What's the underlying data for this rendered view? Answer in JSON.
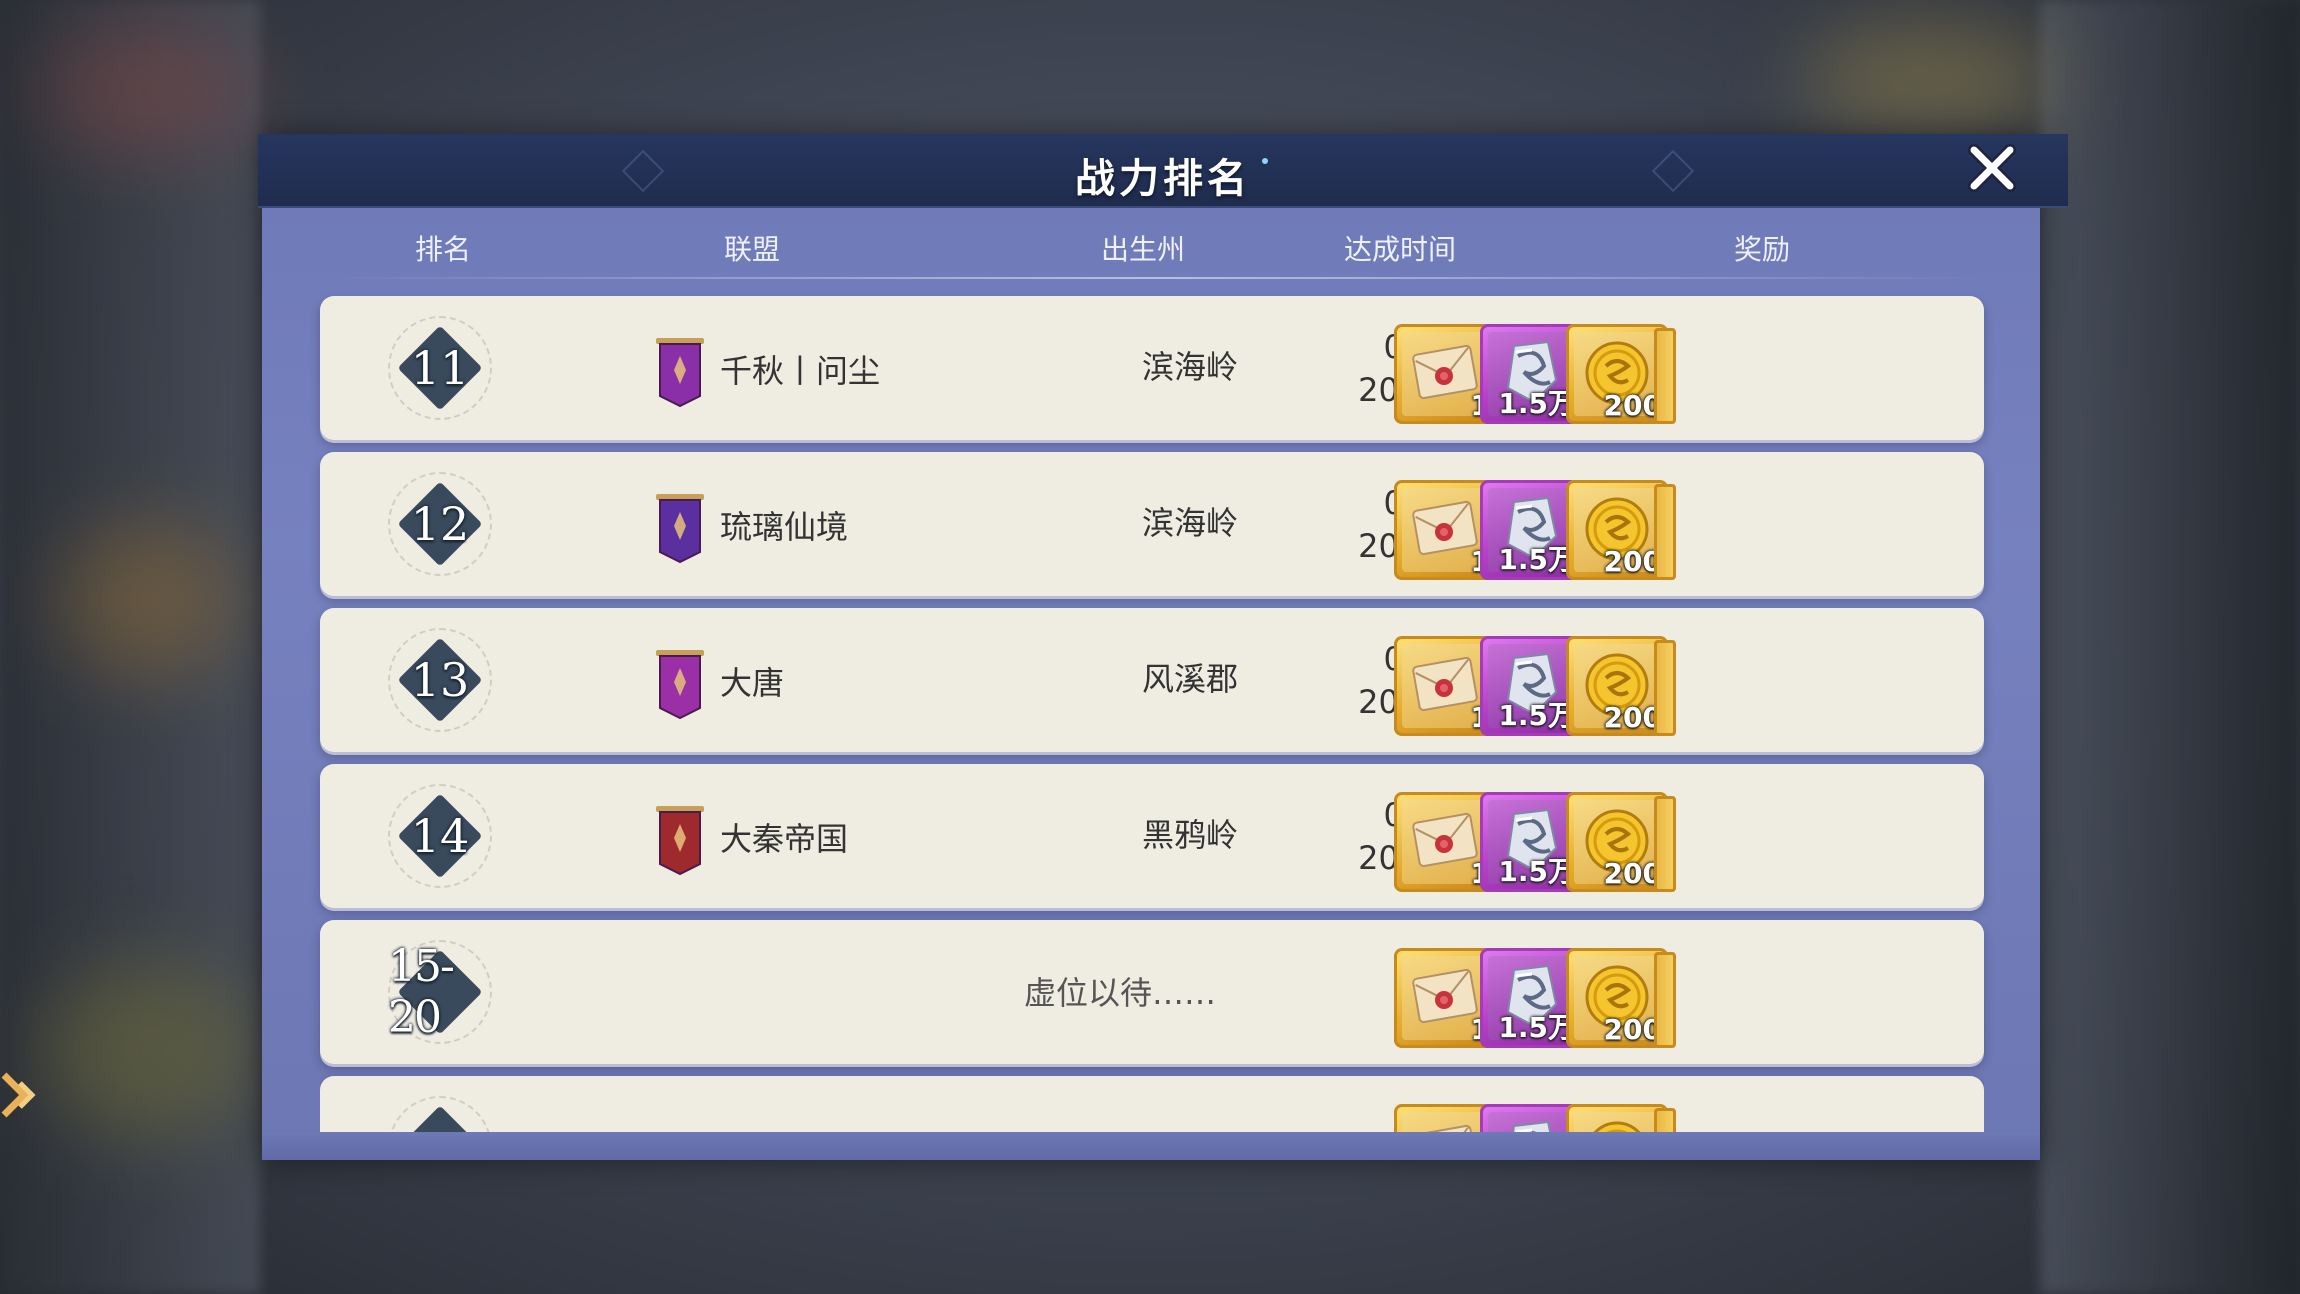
{
  "title": "战力排名",
  "headers": {
    "rank": "排名",
    "alliance": "联盟",
    "state": "出生州",
    "time": "达成时间",
    "reward": "奖励"
  },
  "rewards": [
    {
      "icon": "letter-envelope-icon",
      "qty": "1",
      "frame": "gold"
    },
    {
      "icon": "silver-crystal-icon",
      "qty": "1.5万",
      "frame": "purple"
    },
    {
      "icon": "gold-coin-icon",
      "qty": "200",
      "frame": "gold"
    }
  ],
  "rows": [
    {
      "rank": "11",
      "alliance": "千秋丨问尘",
      "state": "滨海岭",
      "date": "04-02",
      "time": "20:16:44",
      "banner_color": "#8a2fa8"
    },
    {
      "rank": "12",
      "alliance": "琉璃仙境",
      "state": "滨海岭",
      "date": "04-02",
      "time": "20:21:14",
      "banner_color": "#5a2fa0"
    },
    {
      "rank": "13",
      "alliance": "大唐",
      "state": "风溪郡",
      "date": "04-02",
      "time": "20:26:51",
      "banner_color": "#9a2fa8"
    },
    {
      "rank": "14",
      "alliance": "大秦帝国",
      "state": "黑鸦岭",
      "date": "04-02",
      "time": "20:35:57",
      "banner_color": "#9e2a2e"
    }
  ],
  "placeholder_row": {
    "rank": "15-20",
    "text": "虚位以待……"
  },
  "colors": {
    "panel": "#6e79b8",
    "title_bar": "#22304f",
    "row_bg": "#efece2",
    "badge": "#394a5d"
  }
}
